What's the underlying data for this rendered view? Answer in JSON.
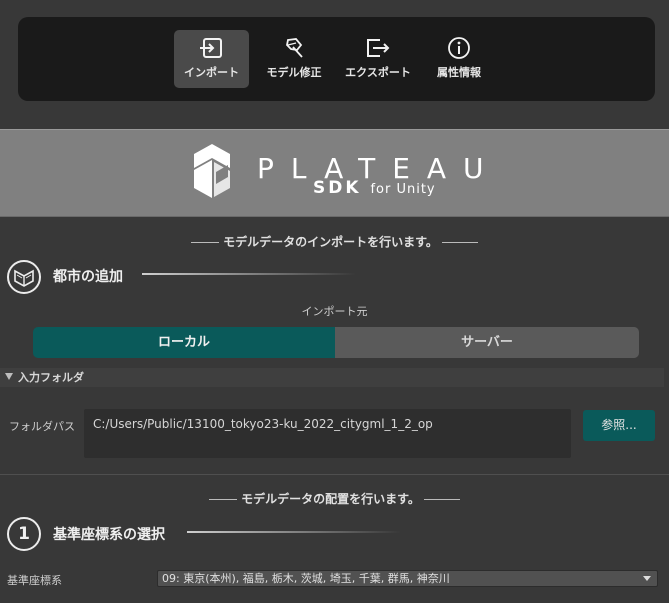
{
  "toolbar": {
    "tools": [
      {
        "label": "インポート",
        "icon": "import-icon",
        "active": true
      },
      {
        "label": "モデル修正",
        "icon": "edit-model-icon",
        "active": false
      },
      {
        "label": "エクスポート",
        "icon": "export-icon",
        "active": false
      },
      {
        "label": "属性情報",
        "icon": "info-icon",
        "active": false
      }
    ]
  },
  "banner": {
    "logo_text": "PLATEAU",
    "sdk": "SDK",
    "sub": "for Unity"
  },
  "import_section": {
    "title": "モデルデータのインポートを行います。",
    "step_title": "都市の追加",
    "source_label": "インポート元",
    "source_options": [
      "ローカル",
      "サーバー"
    ],
    "selected_source": "ローカル",
    "foldout_label": "入力フォルダ",
    "folder_label": "フォルダパス",
    "folder_path": "C:/Users/Public/13100_tokyo23-ku_2022_citygml_1_2_op",
    "browse_label": "参照..."
  },
  "placement_section": {
    "title": "モデルデータの配置を行います。",
    "step_number": "1",
    "step_title": "基準座標系の選択",
    "crs_label": "基準座標系",
    "crs_value": "09: 東京(本州), 福島, 栃木, 茨城, 埼玉, 千葉, 群馬, 神奈川"
  },
  "colors": {
    "accent": "#0a5a5a",
    "panel": "#383838",
    "toolbar": "#1a1a1a",
    "banner": "#808080"
  }
}
